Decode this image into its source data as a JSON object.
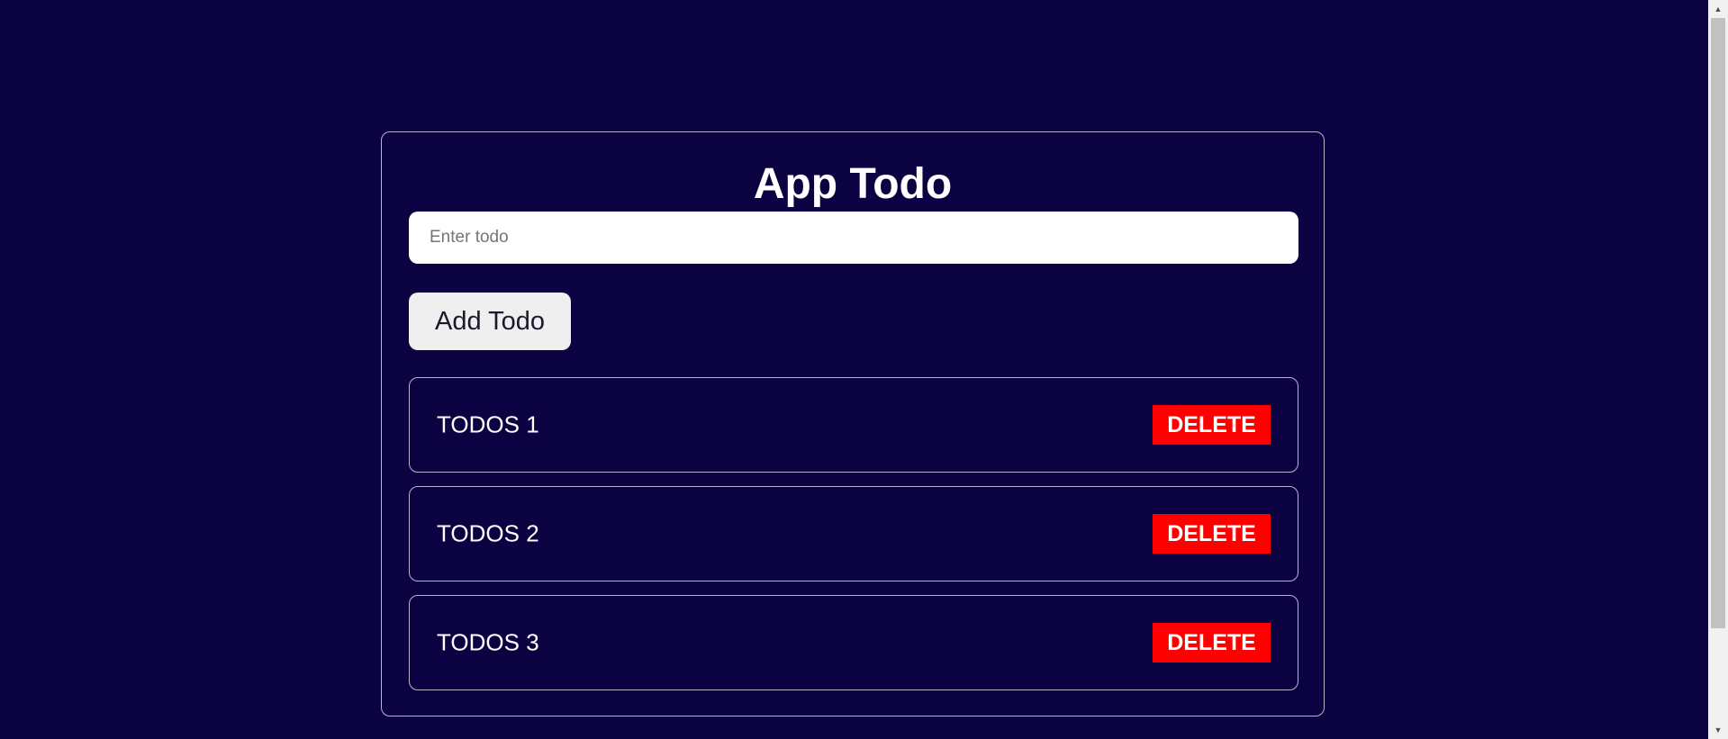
{
  "app": {
    "title": "App Todo"
  },
  "input": {
    "placeholder": "Enter todo",
    "value": ""
  },
  "add_button": {
    "label": "Add Todo"
  },
  "todos": [
    {
      "text": "TODOS 1",
      "delete_label": "DELETE"
    },
    {
      "text": "TODOS 2",
      "delete_label": "DELETE"
    },
    {
      "text": "TODOS 3",
      "delete_label": "DELETE"
    }
  ],
  "colors": {
    "background": "#0b0242",
    "delete": "#ff0000",
    "input_bg": "#ffffff",
    "add_button_bg": "#efefef"
  },
  "icons": {
    "scroll_up": "scroll-up-arrow-icon",
    "scroll_down": "scroll-down-arrow-icon"
  }
}
